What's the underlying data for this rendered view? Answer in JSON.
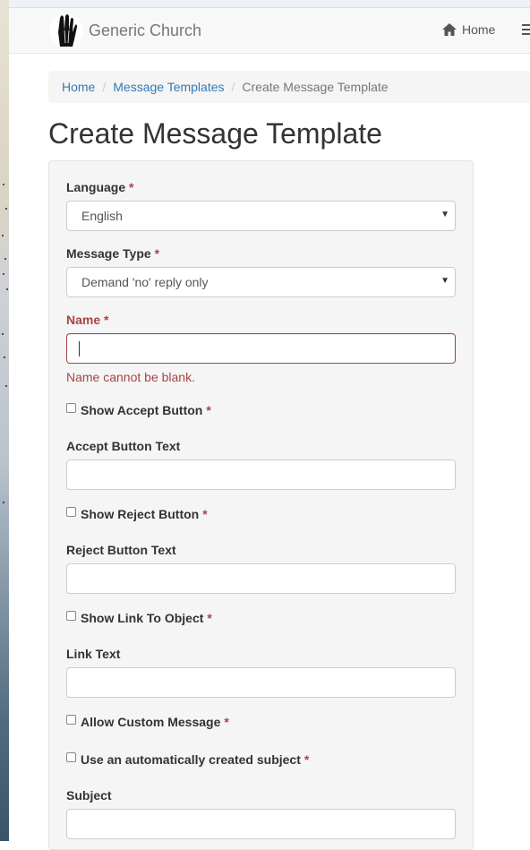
{
  "navbar": {
    "brand": "Generic Church",
    "home_label": "Home"
  },
  "breadcrumb": {
    "home": "Home",
    "templates": "Message Templates",
    "current": "Create Message Template"
  },
  "page": {
    "title": "Create Message Template"
  },
  "form": {
    "required_mark": "*",
    "language": {
      "label": "Language",
      "value": "English"
    },
    "message_type": {
      "label": "Message Type",
      "value": "Demand 'no' reply only"
    },
    "name": {
      "label": "Name",
      "value": "",
      "error": "Name cannot be blank."
    },
    "show_accept": {
      "label": "Show Accept Button",
      "checked": false
    },
    "accept_text": {
      "label": "Accept Button Text",
      "value": ""
    },
    "show_reject": {
      "label": "Show Reject Button",
      "checked": false
    },
    "reject_text": {
      "label": "Reject Button Text",
      "value": ""
    },
    "show_link": {
      "label": "Show Link To Object",
      "checked": false
    },
    "link_text": {
      "label": "Link Text",
      "value": ""
    },
    "allow_custom": {
      "label": "Allow Custom Message",
      "checked": false
    },
    "auto_subject": {
      "label": "Use an automatically created subject",
      "checked": false
    },
    "subject": {
      "label": "Subject",
      "value": ""
    }
  },
  "colors": {
    "link": "#337ab7",
    "error": "#a94442",
    "panel": "#f5f5f5"
  }
}
